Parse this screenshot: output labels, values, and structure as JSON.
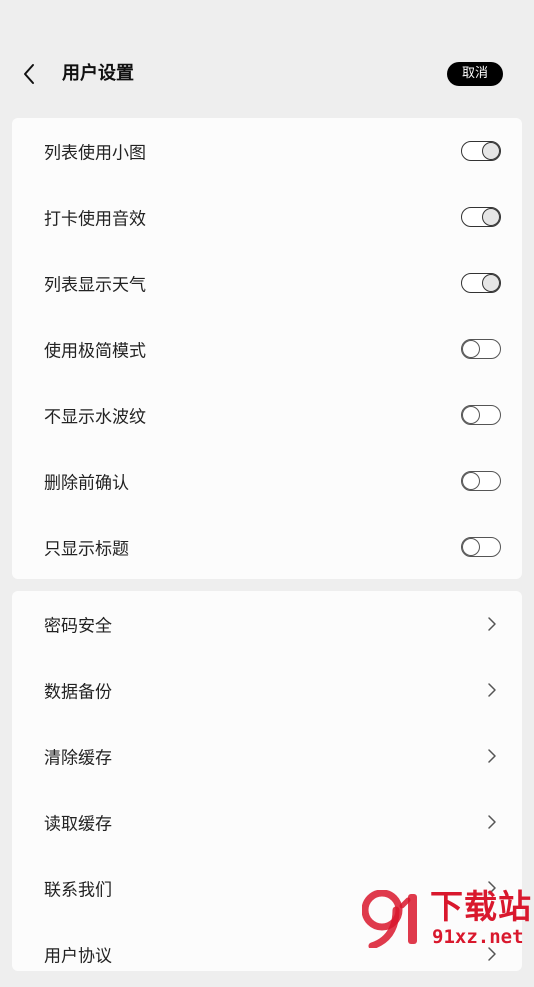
{
  "header": {
    "title": "用户设置",
    "cancel_label": "取消",
    "back_icon": "chevron-left-icon"
  },
  "toggle_settings": [
    {
      "label": "列表使用小图",
      "enabled": true
    },
    {
      "label": "打卡使用音效",
      "enabled": true
    },
    {
      "label": "列表显示天气",
      "enabled": true
    },
    {
      "label": "使用极简模式",
      "enabled": false
    },
    {
      "label": "不显示水波纹",
      "enabled": false
    },
    {
      "label": "删除前确认",
      "enabled": false
    },
    {
      "label": "只显示标题",
      "enabled": false
    }
  ],
  "link_settings": [
    {
      "label": "密码安全",
      "icon": "chevron-right-icon"
    },
    {
      "label": "数据备份",
      "icon": "chevron-right-icon"
    },
    {
      "label": "清除缓存",
      "icon": "chevron-right-icon"
    },
    {
      "label": "读取缓存",
      "icon": "chevron-right-icon"
    },
    {
      "label": "联系我们",
      "icon": "chevron-right-icon"
    },
    {
      "label": "用户协议",
      "icon": "chevron-right-icon"
    }
  ],
  "watermark": {
    "brand_cn": "下载站",
    "url": "91xz.net",
    "accent_color": "#d9182d"
  },
  "colors": {
    "background": "#eeeeee",
    "card": "#fcfcfc",
    "button_bg": "#000000"
  }
}
